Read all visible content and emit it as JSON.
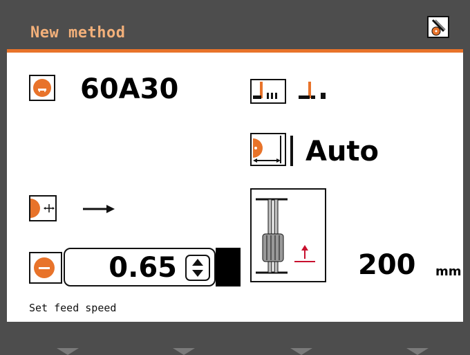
{
  "header": {
    "title": "New method"
  },
  "wheel": {
    "designation": "60A30"
  },
  "dressing": {
    "mode": "Auto"
  },
  "feed": {
    "speed": "0.65"
  },
  "depth": {
    "value": "200",
    "unit": "mm"
  },
  "status": {
    "message": "Set feed speed"
  },
  "colors": {
    "accent": "#e8732a",
    "title_text": "#f3b07a",
    "frame": "#4d4d4d",
    "panel": "#ffffff",
    "indicator_red": "#c8102e"
  }
}
